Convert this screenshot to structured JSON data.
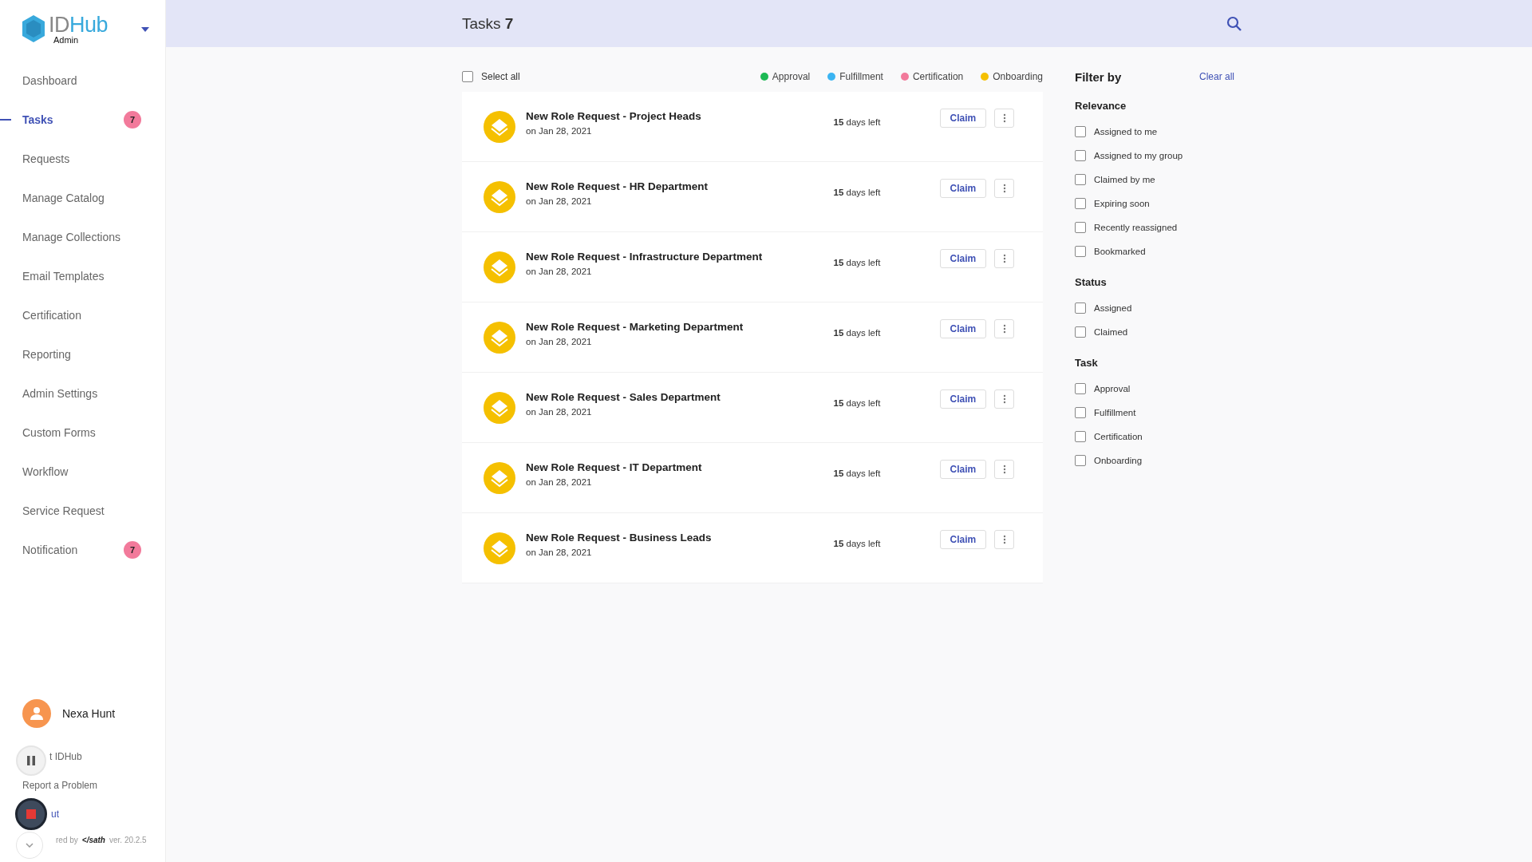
{
  "brand": {
    "part_1": "ID",
    "part_2": "Hub",
    "subtitle": "Admin"
  },
  "sidebar": {
    "items": [
      {
        "label": "Dashboard",
        "selected": false
      },
      {
        "label": "Tasks",
        "selected": true,
        "badge": "7"
      },
      {
        "label": "Requests",
        "selected": false
      },
      {
        "label": "Manage Catalog",
        "selected": false
      },
      {
        "label": "Manage Collections",
        "selected": false
      },
      {
        "label": "Email Templates",
        "selected": false
      },
      {
        "label": "Certification",
        "selected": false
      },
      {
        "label": "Reporting",
        "selected": false
      },
      {
        "label": "Admin Settings",
        "selected": false
      },
      {
        "label": "Custom Forms",
        "selected": false
      },
      {
        "label": "Workflow",
        "selected": false
      },
      {
        "label": "Service Request",
        "selected": false
      },
      {
        "label": "Notification",
        "selected": false,
        "badge": "7"
      }
    ]
  },
  "user": {
    "name": "Nexa Hunt"
  },
  "footer_links": [
    "t IDHub",
    "Report a Problem",
    "ut"
  ],
  "footer": {
    "prefix": "red by",
    "logo": "</sath",
    "version": "ver. 20.2.5"
  },
  "header": {
    "title": "Tasks",
    "count": "7"
  },
  "select_all": {
    "label": "Select all",
    "checked": false
  },
  "legend": [
    {
      "label": "Approval",
      "color": "#1db954"
    },
    {
      "label": "Fulfillment",
      "color": "#3bb4f2"
    },
    {
      "label": "Certification",
      "color": "#f27a9b"
    },
    {
      "label": "Onboarding",
      "color": "#f5c000"
    }
  ],
  "tasks": [
    {
      "title": "New Role Request - Project Heads",
      "date": "on Jan 28, 2021",
      "due": "**15** days left",
      "action": "Claim"
    },
    {
      "title": "New Role Request - HR Department",
      "date": "on Jan 28, 2021",
      "due": "**15** days left",
      "action": "Claim"
    },
    {
      "title": "New Role Request - Infrastructure Department",
      "date": "on Jan 28, 2021",
      "due": "**15** days left",
      "action": "Claim"
    },
    {
      "title": "New Role Request - Marketing Department",
      "date": "on Jan 28, 2021",
      "due": "**15** days left",
      "action": "Claim"
    },
    {
      "title": "New Role Request - Sales Department",
      "date": "on Jan 28, 2021",
      "due": "**15** days left",
      "action": "Claim"
    },
    {
      "title": "New Role Request - IT Department",
      "date": "on Jan 28, 2021",
      "due": "**15** days left",
      "action": "Claim"
    },
    {
      "title": "New Role Request - Business Leads",
      "date": "on Jan 28, 2021",
      "due": "**15** days left",
      "action": "Claim"
    }
  ],
  "filter": {
    "title": "Filter by",
    "clear": "Clear all",
    "groups": [
      {
        "title": "Relevance",
        "options": [
          {
            "label": "Assigned to me",
            "checked": false
          },
          {
            "label": "Assigned to my group",
            "checked": false
          },
          {
            "label": "Claimed by me",
            "checked": false
          },
          {
            "label": "Expiring soon",
            "checked": false
          },
          {
            "label": "Recently reassigned",
            "checked": false
          },
          {
            "label": "Bookmarked",
            "checked": false
          }
        ]
      },
      {
        "title": "Status",
        "options": [
          {
            "label": "Assigned",
            "checked": false
          },
          {
            "label": "Claimed",
            "checked": false
          }
        ]
      },
      {
        "title": "Task",
        "options": [
          {
            "label": "Approval",
            "checked": false
          },
          {
            "label": "Fulfillment",
            "checked": false
          },
          {
            "label": "Certification",
            "checked": false
          },
          {
            "label": "Onboarding",
            "checked": false
          }
        ]
      }
    ]
  }
}
